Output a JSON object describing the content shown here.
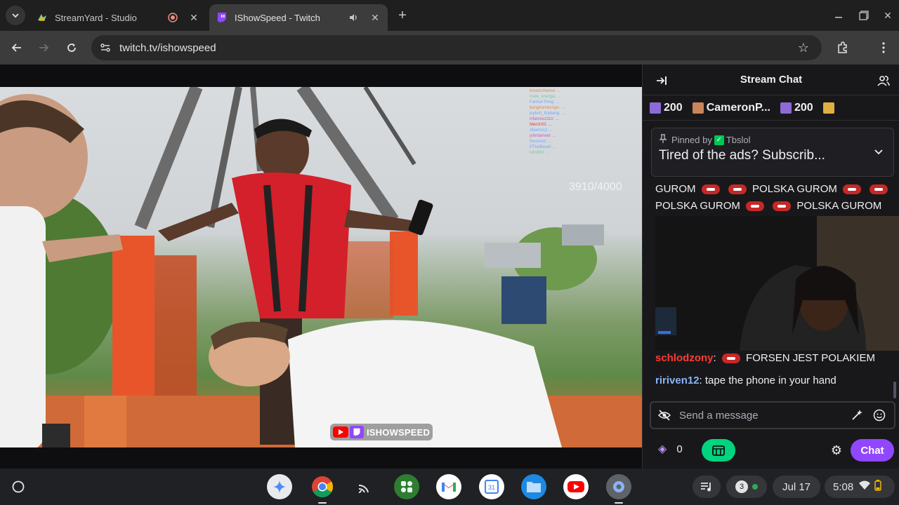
{
  "browser": {
    "tabs": [
      {
        "title": "StreamYard - Studio",
        "icon": "streamyard-icon",
        "active": false,
        "indicator": "recording-icon"
      },
      {
        "title": "IShowSpeed - Twitch",
        "icon": "twitch-icon",
        "active": true,
        "indicator": "audio-icon"
      }
    ],
    "url": "twitch.tv/ishowspeed"
  },
  "video": {
    "counter": "3910/4000",
    "channel_watermark": "ISHOWSPEED",
    "overlay_chat": [
      "kreamcheese: ...",
      "mala_energia: ...",
      "FartherThing: ...",
      "benghombonge: ...",
      "joyboii_thabang: ...",
      "infamouz3zz: ...",
      "MenXXII: ...",
      "Alberto1z: ...",
      "johntameel: ...",
      "theocool: ...",
      "PTheBandI: ...",
      "vdnd0d: ..."
    ]
  },
  "chat": {
    "title": "Stream Chat",
    "gifts": [
      {
        "label": "200",
        "user": ""
      },
      {
        "label": "",
        "user": "CameronP..."
      },
      {
        "label": "200",
        "user": ""
      }
    ],
    "pinned": {
      "prefix": "Pinned by",
      "by": "Tbslol",
      "text": "Tired of the ads? Subscrib..."
    },
    "spam_line_1": [
      "GUROM",
      "POLSKA GUROM"
    ],
    "spam_line_2": [
      "POLSKA GUROM",
      "POLSKA GUROM"
    ],
    "messages": [
      {
        "user": "schlodzony",
        "text": "FORSEN JEST POLAKIEM",
        "color": "#ff3b30"
      },
      {
        "user": "ririven12",
        "text": "tape the phone in your hand",
        "color": "#8ab4f8"
      }
    ],
    "input_placeholder": "Send a message",
    "points": "0",
    "chat_button": "Chat"
  },
  "shelf": {
    "apps": [
      "gemini-icon",
      "chrome-icon",
      "cast-icon",
      "app-launcher-grid-icon",
      "gmail-icon",
      "calendar-icon",
      "files-icon",
      "youtube-icon",
      "settings-icon"
    ],
    "notifications": "3",
    "date": "Jul 17",
    "time": "5:08"
  },
  "colors": {
    "twitch_purple": "#9147ff",
    "prediction_green": "#00d47e",
    "chat_bg": "#18181b"
  }
}
